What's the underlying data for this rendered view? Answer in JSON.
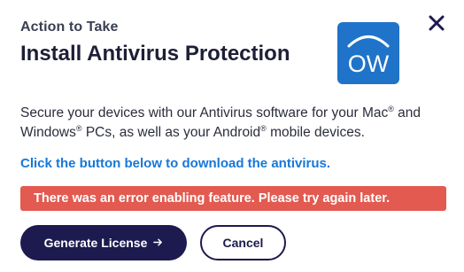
{
  "dialog": {
    "kicker": "Action to Take",
    "title": "Install Antivirus Protection",
    "close_icon": "close-icon",
    "logo": {
      "text": "OW",
      "icon": "ow-logo",
      "background": "#1f73c9"
    },
    "body": {
      "part1": "Secure your devices with our Antivirus software for your Mac",
      "reg1": "®",
      "part2": " and Windows",
      "reg2": "®",
      "part3": " PCs, as well as your Android",
      "reg3": "®",
      "part4": " mobile devices."
    },
    "cta_text": "Click the button below to download the antivirus.",
    "error_message": "There was an error enabling feature. Please try again later.",
    "buttons": {
      "generate_label": "Generate License",
      "generate_icon": "arrow-right-icon",
      "cancel_label": "Cancel"
    },
    "colors": {
      "primary": "#1c1a4f",
      "link": "#1778d8",
      "error": "#e25a50"
    }
  }
}
